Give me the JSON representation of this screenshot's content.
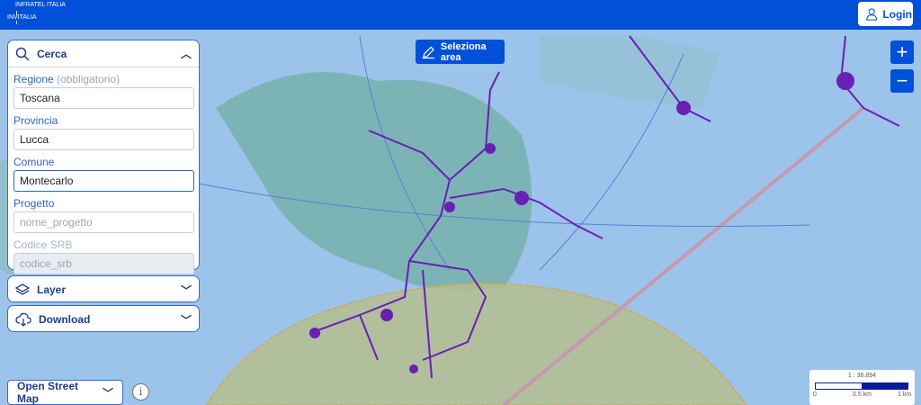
{
  "header": {
    "logo_top": "INFRATEL ITALIA",
    "logo_bottom": "INVITALIA",
    "login_label": "Login"
  },
  "search": {
    "title": "Cerca",
    "regione_label": "Regione",
    "regione_hint": "(obbligatorio)",
    "regione_value": "Toscana",
    "provincia_label": "Provincia",
    "provincia_value": "Lucca",
    "comune_label": "Comune",
    "comune_value": "Montecarlo",
    "progetto_label": "Progetto",
    "progetto_placeholder": "nome_progetto",
    "srb_label": "Codice SRB",
    "srb_placeholder": "codice_srb"
  },
  "layer": {
    "title": "Layer"
  },
  "download": {
    "title": "Download"
  },
  "basemap": {
    "selected": "Open Street Map"
  },
  "toolbar": {
    "select_area": "Seleziona area",
    "zoom_in": "+",
    "zoom_out": "−"
  },
  "scale": {
    "ratio": "1 : 36.894",
    "t0": "0",
    "t1": "0.5 km",
    "t2": "1 km"
  },
  "colors": {
    "primary": "#0250d9",
    "network": "#6a1fb5"
  }
}
